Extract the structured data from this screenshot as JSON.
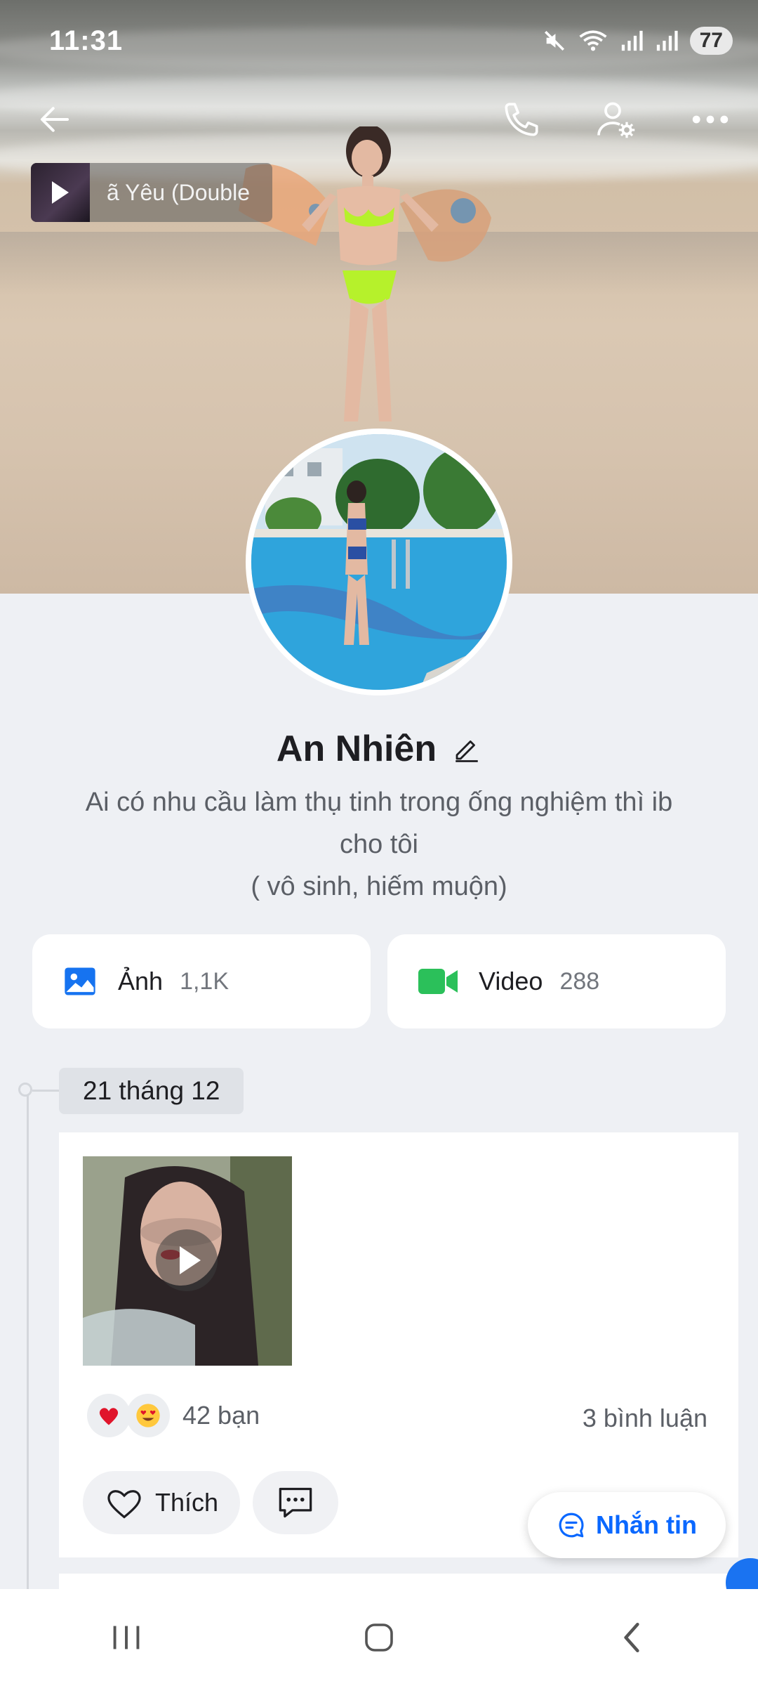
{
  "status_bar": {
    "time": "11:31",
    "battery": "77",
    "icons": [
      "mute-icon",
      "wifi-icon",
      "signal-icon",
      "signal-icon"
    ]
  },
  "header": {
    "back_icon": "arrow-left-icon",
    "call_icon": "phone-icon",
    "settings_icon": "user-settings-icon",
    "more_icon": "more-dots-icon"
  },
  "music": {
    "title": "ã Yêu (Double"
  },
  "profile": {
    "name": "An Nhiên",
    "edit_icon": "pencil-icon",
    "bio_line1": "Ai có nhu cầu làm thụ tinh trong ống nghiệm thì ib",
    "bio_line2": "cho tôi",
    "bio_line3": "( vô sinh, hiếm muộn)"
  },
  "media": {
    "photos": {
      "label": "Ảnh",
      "count": "1,1K"
    },
    "videos": {
      "label": "Video",
      "count": "288"
    }
  },
  "timeline": {
    "date": "21 tháng 12",
    "post": {
      "reactions": [
        "heart-emoji",
        "heart-eyes-emoji"
      ],
      "reaction_count": "42 bạn",
      "comments": "3 bình luận",
      "like_label": "Thích"
    }
  },
  "message_button": {
    "label": "Nhắn tin"
  },
  "colors": {
    "accent": "#0a68ff",
    "photo_icon": "#1673f0",
    "video_icon": "#2bc05a",
    "background": "#eef0f4"
  }
}
